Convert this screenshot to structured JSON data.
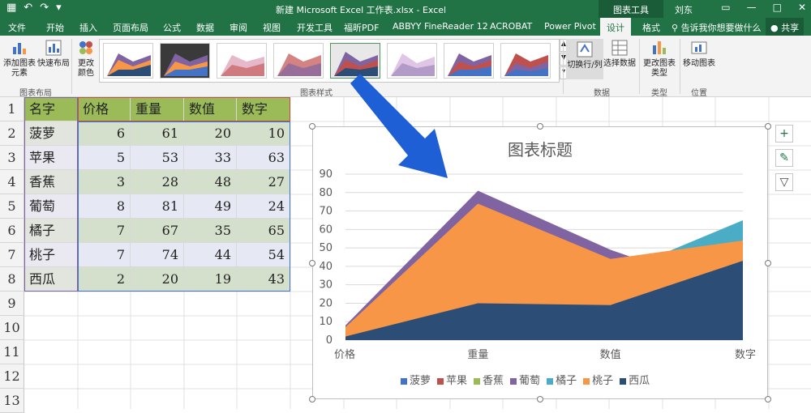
{
  "titlebar": {
    "document_title": "新建 Microsoft Excel 工作表.xlsx  -  Excel",
    "chart_tools": "图表工具",
    "user": "刘东",
    "window_icons": [
      "minimize-icon",
      "restore-icon",
      "close-icon"
    ]
  },
  "tabs": {
    "items": [
      "文件",
      "开始",
      "插入",
      "页面布局",
      "公式",
      "数据",
      "审阅",
      "视图",
      "开发工具",
      "福昕PDF",
      "ABBYY FineReader 12",
      "ACROBAT",
      "Power Pivot",
      "设计",
      "格式"
    ],
    "active": "设计",
    "search": "告诉我你想要做什么",
    "share": "共享"
  },
  "ribbon": {
    "add_element": "添加图表元素",
    "quick_layout": "快速布局",
    "change_color": "更改颜色",
    "group_layout": "图表布局",
    "group_styles": "图表样式",
    "switch_rowcol": "切换行/列",
    "select_data": "选择数据",
    "group_data": "数据",
    "change_type": "更改图表类型",
    "group_type": "类型",
    "move_chart": "移动图表",
    "group_location": "位置"
  },
  "sheet": {
    "headers": [
      "名字",
      "价格",
      "重量",
      "数值",
      "数字"
    ],
    "rows": [
      [
        "菠萝",
        "6",
        "61",
        "20",
        "10"
      ],
      [
        "苹果",
        "5",
        "53",
        "33",
        "63"
      ],
      [
        "香蕉",
        "3",
        "28",
        "48",
        "27"
      ],
      [
        "葡萄",
        "8",
        "81",
        "49",
        "24"
      ],
      [
        "橘子",
        "7",
        "67",
        "35",
        "65"
      ],
      [
        "桃子",
        "7",
        "74",
        "44",
        "54"
      ],
      [
        "西瓜",
        "2",
        "20",
        "19",
        "43"
      ]
    ],
    "row_numbers": [
      "1",
      "2",
      "3",
      "4",
      "5",
      "6",
      "7",
      "8",
      "9",
      "10",
      "11",
      "12",
      "13"
    ]
  },
  "colors": {
    "excel_green": "#217346",
    "header_fill": "#9bbb59"
  },
  "chart_data": {
    "type": "area",
    "title": "图表标题",
    "categories": [
      "价格",
      "重量",
      "数值",
      "数字"
    ],
    "ylim": [
      0,
      90
    ],
    "yticks": [
      "0",
      "10",
      "20",
      "30",
      "40",
      "50",
      "60",
      "70",
      "80",
      "90"
    ],
    "grid": true,
    "legend_position": "bottom",
    "series": [
      {
        "name": "菠萝",
        "color": "#4472c4",
        "values": [
          6,
          61,
          20,
          10
        ]
      },
      {
        "name": "苹果",
        "color": "#c0504d",
        "values": [
          5,
          53,
          33,
          63
        ]
      },
      {
        "name": "香蕉",
        "color": "#9bbb59",
        "values": [
          3,
          28,
          48,
          27
        ]
      },
      {
        "name": "葡萄",
        "color": "#8064a2",
        "values": [
          8,
          81,
          49,
          24
        ]
      },
      {
        "name": "橘子",
        "color": "#4bacc6",
        "values": [
          7,
          67,
          35,
          65
        ]
      },
      {
        "name": "桃子",
        "color": "#f79646",
        "values": [
          7,
          74,
          44,
          54
        ]
      },
      {
        "name": "西瓜",
        "color": "#2c4d75",
        "values": [
          2,
          20,
          19,
          43
        ]
      }
    ]
  }
}
